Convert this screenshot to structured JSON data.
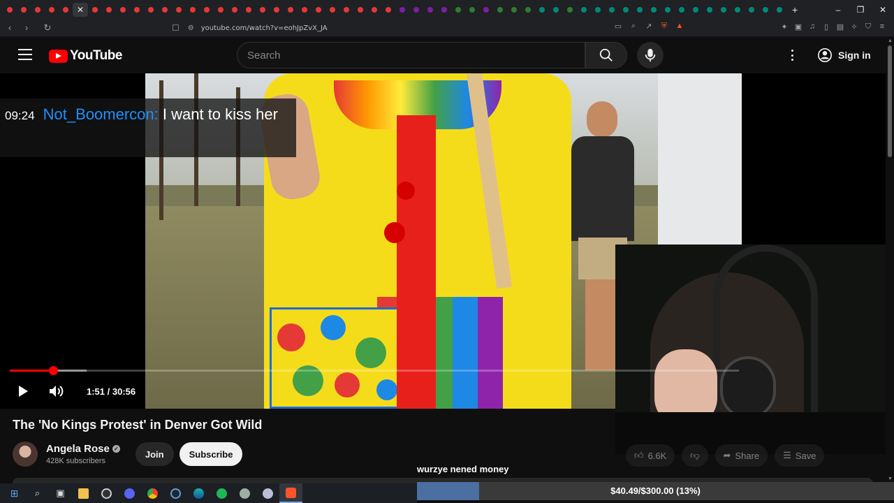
{
  "browser": {
    "url": "youtube.com/watch?v=eohJpZvX_JA",
    "active_tab_glyph": "✕",
    "new_tab_glyph": "+",
    "tab_favicon_colors": [
      "red",
      "red",
      "red",
      "red",
      "red",
      "red",
      "red",
      "red",
      "red",
      "red",
      "red",
      "red",
      "red",
      "red",
      "red",
      "red",
      "red",
      "red",
      "red",
      "red",
      "red",
      "red",
      "red",
      "red",
      "red",
      "red",
      "red",
      "purple",
      "purple",
      "purple",
      "purple",
      "green",
      "green",
      "purple",
      "green",
      "green",
      "green",
      "teal",
      "teal",
      "green",
      "teal",
      "teal",
      "teal",
      "teal",
      "teal",
      "teal",
      "teal",
      "teal",
      "teal",
      "teal",
      "teal",
      "teal",
      "teal",
      "teal",
      "teal"
    ],
    "window_controls": [
      "–",
      "❐",
      "✕"
    ]
  },
  "youtube": {
    "logo_text": "YouTube",
    "search_placeholder": "Search",
    "signin_label": "Sign in"
  },
  "chat_overlay": {
    "time": "09:24",
    "user": "Not_Boomercon:",
    "message": "I want to kiss her",
    "user_color": "#1e90ff"
  },
  "player": {
    "time_display": "1:51 / 30:56",
    "progress_fraction": 0.0598,
    "buffer_fraction": 0.105,
    "accent_color": "#ff0000"
  },
  "video": {
    "title": "The 'No Kings Protest' in Denver Got Wild"
  },
  "channel": {
    "name": "Angela Rose",
    "verified_glyph": "✓",
    "subscribers": "428K subscribers",
    "join_label": "Join",
    "subscribe_label": "Subscribe"
  },
  "actions": {
    "likes": "6.6K",
    "share_label": "Share",
    "save_label": "Save"
  },
  "donation": {
    "label": "wurzye nened money",
    "progress_text": "$40.49/$300.00 (13%)",
    "progress_fraction": 0.13
  },
  "taskbar": {
    "icons": [
      "windows-start-icon",
      "search-icon",
      "task-view-icon",
      "file-explorer-icon",
      "obs-icon",
      "discord-icon",
      "chrome-icon",
      "steam-icon",
      "edge-icon",
      "spotify-icon",
      "app-icon",
      "app-icon-2",
      "brave-icon"
    ]
  }
}
